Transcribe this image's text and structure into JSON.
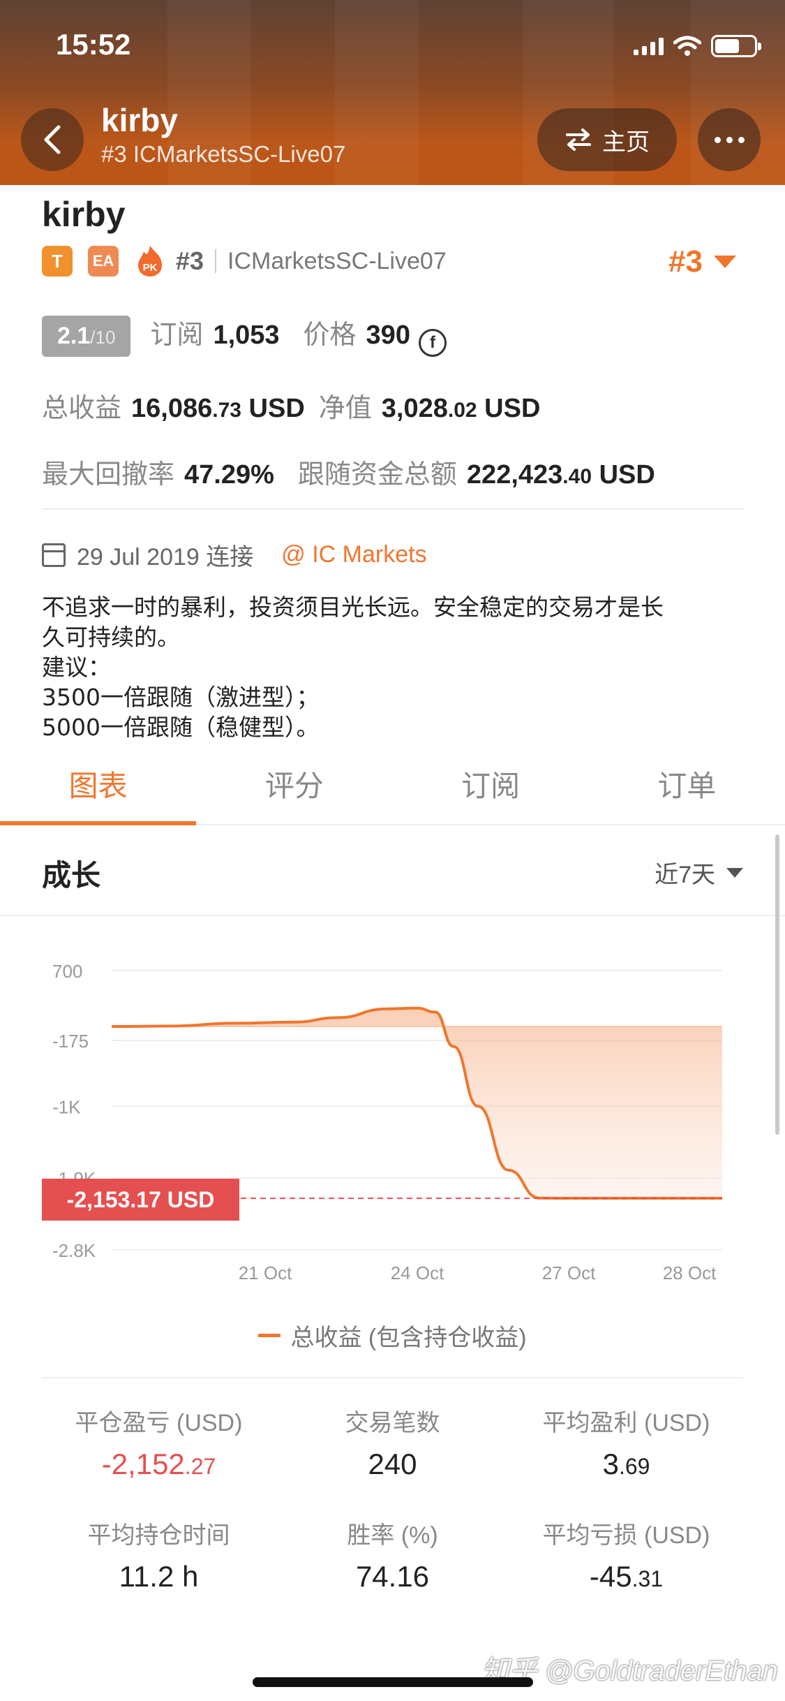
{
  "status_bar": {
    "time": "15:52"
  },
  "header": {
    "title": "kirby",
    "subtitle": "#3 ICMarketsSC-Live07",
    "home_label": "主页"
  },
  "profile": {
    "name": "kirby",
    "badge_t": "T",
    "badge_ea": "EA",
    "badge_pk": "PK",
    "rank": "#3",
    "server": "ICMarketsSC-Live07",
    "rank_right": "#3",
    "score": "2.1",
    "score_max": "/10",
    "subscribe_label": "订阅",
    "subscribe_value": "1,053",
    "price_label": "价格",
    "price_value": "390",
    "coin_symbol": "f",
    "total_profit_label": "总收益",
    "total_profit_int": "16,086",
    "total_profit_dec": ".73",
    "total_profit_unit": "USD",
    "equity_label": "净值",
    "equity_int": "3,028",
    "equity_dec": ".02",
    "equity_unit": "USD",
    "drawdown_label": "最大回撤率",
    "drawdown_value": "47.29%",
    "follow_label": "跟随资金总额",
    "follow_int": "222,423",
    "follow_dec": ".40",
    "follow_unit": "USD",
    "connect_date": "29 Jul 2019 连接",
    "broker": "@ IC Markets",
    "bio_lines": [
      "不追求一时的暴利，投资须目光长远。安全稳定的交易才是长",
      "久可持续的。",
      "建议：",
      "3500一倍跟随（激进型）；",
      "5000一倍跟随（稳健型）。"
    ]
  },
  "tabs": [
    "图表",
    "评分",
    "订阅",
    "订单"
  ],
  "growth": {
    "title": "成长",
    "range": "近7天",
    "current_value": "-2,153.17 USD",
    "legend": "总收益 (包含持仓收益)"
  },
  "chart_data": {
    "type": "area",
    "y_ticks": [
      "700",
      "-175",
      "-1K",
      "-1.9K",
      "-2.8K"
    ],
    "y_tick_values": [
      700,
      -175,
      -1000,
      -1900,
      -2800
    ],
    "x_ticks": [
      "21 Oct",
      "24 Oct",
      "27 Oct",
      "28 Oct"
    ],
    "ylim": [
      -2800,
      700
    ],
    "series": [
      {
        "name": "总收益 (包含持仓收益)",
        "x": [
          0,
          0.1,
          0.2,
          0.3,
          0.37,
          0.45,
          0.5,
          0.53,
          0.56,
          0.6,
          0.65,
          0.7,
          0.74,
          0.8,
          1.0
        ],
        "y": [
          0,
          5,
          40,
          55,
          110,
          220,
          230,
          180,
          -250,
          -1000,
          -1800,
          -2150,
          -2153,
          -2153,
          -2153
        ]
      }
    ],
    "baseline": 0,
    "current_line": -2153.17
  },
  "metrics": [
    {
      "label": "平仓盈亏 (USD)",
      "int": "-2,152",
      "dec": ".27",
      "negative": true
    },
    {
      "label": "交易笔数",
      "int": "240",
      "dec": "",
      "negative": false
    },
    {
      "label": "平均盈利 (USD)",
      "int": "3",
      "dec": ".69",
      "negative": false
    },
    {
      "label": "平均持仓时间",
      "int": "11.2 h",
      "dec": "",
      "negative": false
    },
    {
      "label": "胜率 (%)",
      "int": "74.16",
      "dec": "",
      "negative": false
    },
    {
      "label": "平均亏损 (USD)",
      "int": "-45",
      "dec": ".31",
      "negative": false
    }
  ],
  "watermark": "知乎 @GoldtraderEthan",
  "colors": {
    "accent": "#f0762d",
    "negative": "#e4504f"
  }
}
